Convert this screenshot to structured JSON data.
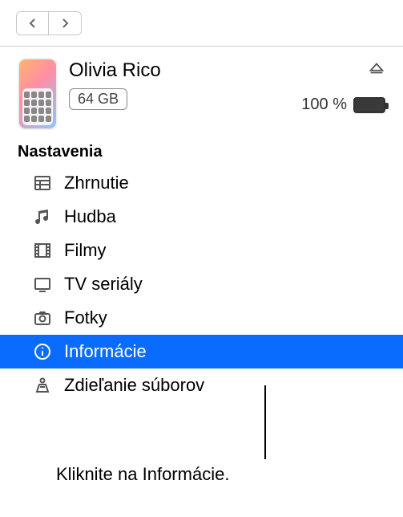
{
  "device": {
    "name": "Olivia Rico",
    "storage": "64 GB",
    "battery_pct": "100 %"
  },
  "sidebar": {
    "section_title": "Nastavenia",
    "items": [
      {
        "label": "Zhrnutie",
        "icon": "summary"
      },
      {
        "label": "Hudba",
        "icon": "music"
      },
      {
        "label": "Filmy",
        "icon": "movies"
      },
      {
        "label": "TV seriály",
        "icon": "tv"
      },
      {
        "label": "Fotky",
        "icon": "photos"
      },
      {
        "label": "Informácie",
        "icon": "info",
        "selected": true
      },
      {
        "label": "Zdieľanie súborov",
        "icon": "files"
      }
    ]
  },
  "caption": "Kliknite na Informácie."
}
